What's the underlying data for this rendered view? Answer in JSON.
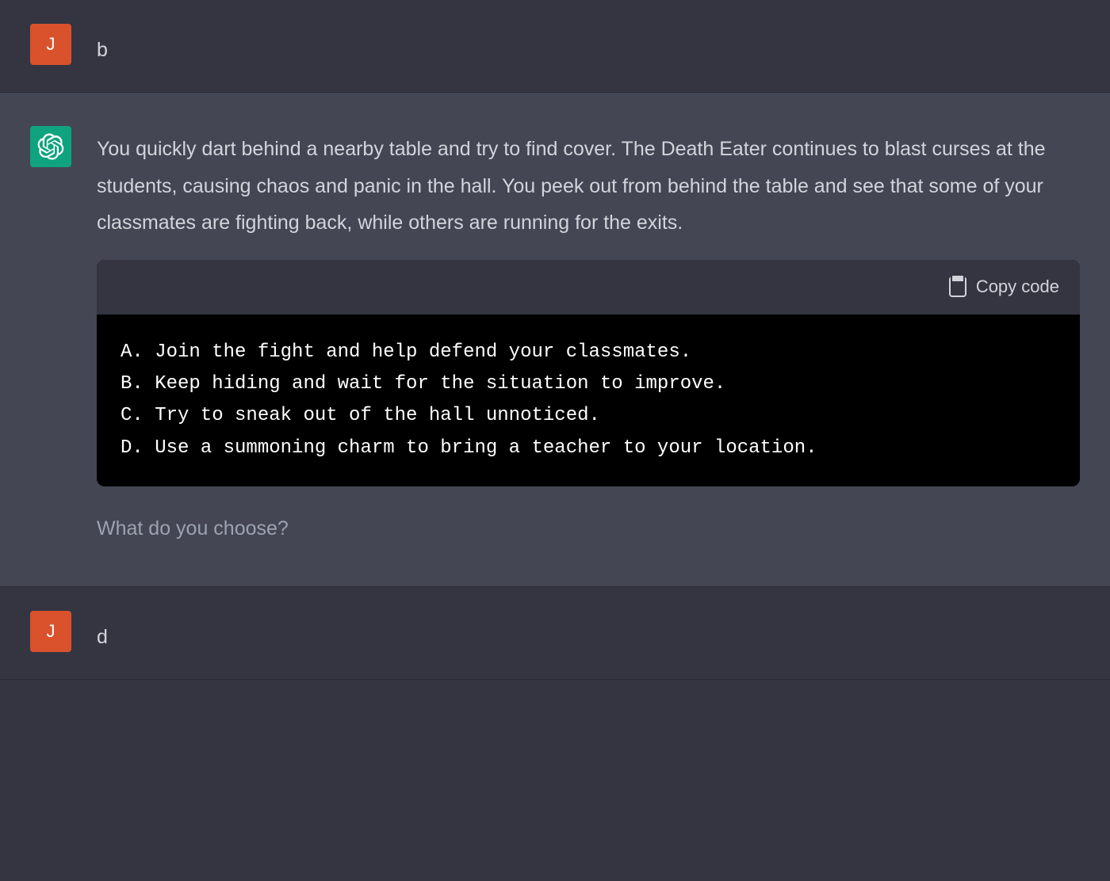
{
  "messages": {
    "user1": {
      "avatar_letter": "J",
      "text": "b"
    },
    "assistant": {
      "paragraph": "You quickly dart behind a nearby table and try to find cover. The Death Eater continues to blast curses at the students, causing chaos and panic in the hall. You peek out from behind the table and see that some of your classmates are fighting back, while others are running for the exits.",
      "copy_label": "Copy code",
      "code_lines": {
        "a": "A. Join the fight and help defend your classmates.",
        "b": "B. Keep hiding and wait for the situation to improve.",
        "c": "C. Try to sneak out of the hall unnoticed.",
        "d": "D. Use a summoning charm to bring a teacher to your location."
      },
      "closing": "What do you choose?"
    },
    "user2": {
      "avatar_letter": "J",
      "text": "d"
    }
  }
}
